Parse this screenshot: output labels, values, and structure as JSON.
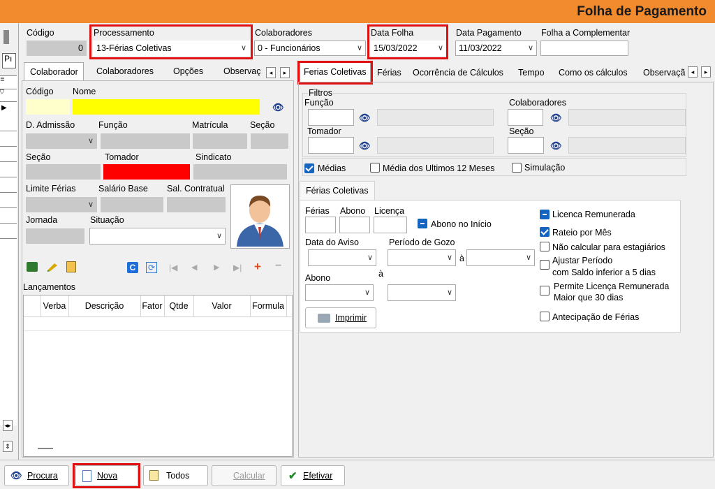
{
  "window": {
    "title": "Folha de Pagamento"
  },
  "header": {
    "codigo_label": "Código",
    "codigo_value": "0",
    "processamento_label": "Processamento",
    "processamento_value": "13-Férias Coletivas",
    "colaboradores_label": "Colaboradores",
    "colaboradores_value": "0 - Funcionários",
    "data_folha_label": "Data Folha",
    "data_folha_value": "15/03/2022",
    "data_pagamento_label": "Data Pagamento",
    "data_pagamento_value": "11/03/2022",
    "folha_complementar_label": "Folha a Complementar"
  },
  "left_tabs": [
    "Colaborador",
    "Colaboradores",
    "Opções",
    "Observaç"
  ],
  "left_form": {
    "codigo": "Código",
    "nome": "Nome",
    "admissao": "D. Admissão",
    "funcao": "Função",
    "matricula": "Matrícula",
    "secao": "Seção",
    "secao2": "Seção",
    "tomador": "Tomador",
    "sindicato": "Sindicato",
    "limite_ferias": "Limite Férias",
    "salario_base": "Salário Base",
    "sal_contratual": "Sal. Contratual",
    "jornada": "Jornada",
    "situacao": "Situação"
  },
  "lancamentos": {
    "title": "Lançamentos",
    "columns": [
      "Verba",
      "Descrição",
      "Fator",
      "Qtde",
      "Valor",
      "Formula"
    ]
  },
  "right_tabs": [
    "Ferias Coletivas",
    "Férias",
    "Ocorrência de Cálculos",
    "Tempo",
    "Como os cálculos",
    "Observaçã"
  ],
  "filtros": {
    "title": "Filtros",
    "funcao": "Função",
    "tomador": "Tomador",
    "colaboradores": "Colaboradores",
    "secao": "Seção"
  },
  "options": {
    "medias": "Médias",
    "medias_ultimos": "Média dos Ultimos 12 Meses",
    "simulacao": "Simulação"
  },
  "ferias_coletivas": {
    "tab": "Férias Coletivas",
    "ferias": "Férias",
    "abono": "Abono",
    "licenca": "Licença",
    "abono_inicio": "Abono no Início",
    "data_aviso": "Data do Aviso",
    "periodo_gozo": "Período de Gozo",
    "a1": "à",
    "abono2": "Abono",
    "a2": "à",
    "imprimir": "Imprimir",
    "licenca_remunerada": "Licenca Remunerada",
    "rateio_mes": "Rateio por Mês",
    "nao_calcular": "Não calcular para estagiários",
    "ajustar_1": "Ajustar Período",
    "ajustar_2": "com Saldo inferior a 5 dias",
    "permite_1": "Permite Licença Remunerada",
    "permite_2": "Maior que 30 dias",
    "antecipacao": "Antecipação de Férias"
  },
  "side_strip": {
    "p_label": "Pı"
  },
  "footer": {
    "procura": "Procura",
    "nova": "Nova",
    "todos": "Todos",
    "calcular": "Calcular",
    "efetivar": "Efetivar"
  }
}
